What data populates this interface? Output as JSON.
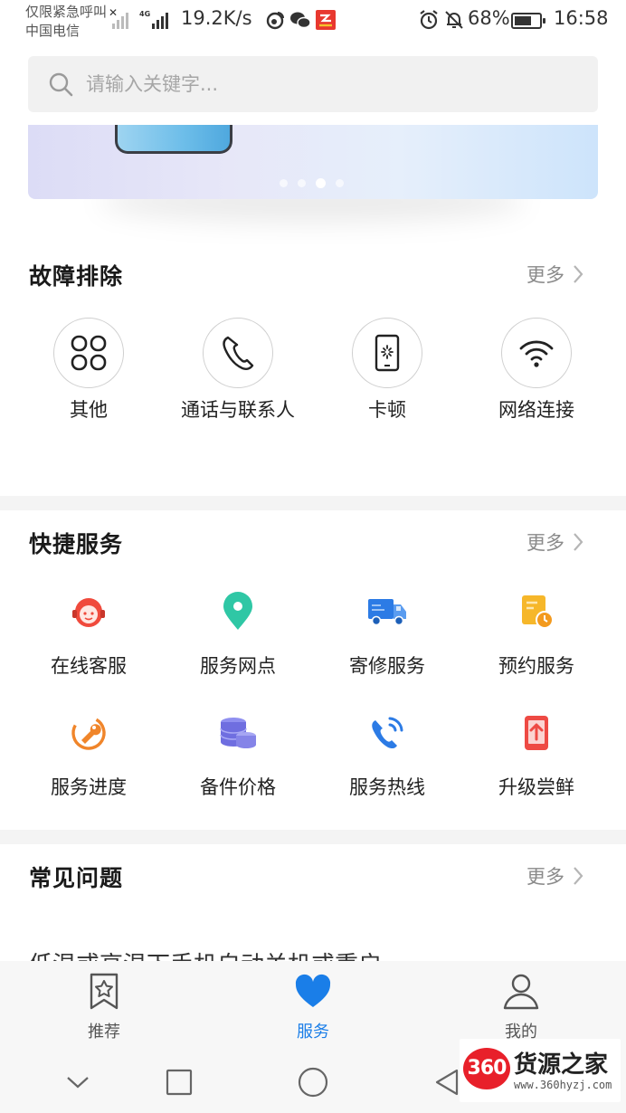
{
  "status_bar": {
    "carrier_line1": "仅限紧急呼叫",
    "carrier_line2": "中国电信",
    "net_speed": "19.2K/s",
    "network_type": "4G",
    "battery_percent": "68%",
    "battery_level": 0.68,
    "time": "16:58",
    "icons": [
      "close-icon",
      "signal-icon",
      "4g-signal-icon",
      "weibo-icon",
      "wechat-icon",
      "app-notification-icon",
      "alarm-icon",
      "mute-bell-icon",
      "battery-icon"
    ]
  },
  "search": {
    "placeholder": "请输入关键字..."
  },
  "banner": {
    "slide_count": 4,
    "active_slide": 3
  },
  "troubleshoot": {
    "title": "故障排除",
    "more": "更多",
    "items": [
      {
        "label": "其他",
        "icon": "four-petal-icon"
      },
      {
        "label": "通话与联系人",
        "icon": "phone-call-icon"
      },
      {
        "label": "卡顿",
        "icon": "phone-loading-icon"
      },
      {
        "label": "网络连接",
        "icon": "wifi-icon"
      }
    ]
  },
  "quick_services": {
    "title": "快捷服务",
    "more": "更多",
    "items": [
      {
        "label": "在线客服",
        "icon": "customer-service-icon",
        "color": "#f04a3c"
      },
      {
        "label": "服务网点",
        "icon": "location-pin-icon",
        "color": "#2fc7a5"
      },
      {
        "label": "寄修服务",
        "icon": "truck-icon",
        "color": "#2c7be5"
      },
      {
        "label": "预约服务",
        "icon": "appointment-icon",
        "color": "#f6b72a"
      },
      {
        "label": "服务进度",
        "icon": "wrench-progress-icon",
        "color": "#f0852a"
      },
      {
        "label": "备件价格",
        "icon": "coins-stack-icon",
        "color": "#6f6ee0"
      },
      {
        "label": "服务热线",
        "icon": "hotline-phone-icon",
        "color": "#2c7be5"
      },
      {
        "label": "升级尝鲜",
        "icon": "upgrade-phone-icon",
        "color": "#ee4a44"
      }
    ]
  },
  "faq": {
    "title": "常见问题",
    "more": "更多",
    "first_item_clipped": "低温或高温下手机自动关机或重启"
  },
  "tab_bar": {
    "tabs": [
      {
        "label": "推荐",
        "icon": "bookmark-star-icon",
        "active": false
      },
      {
        "label": "服务",
        "icon": "heart-icon",
        "active": true
      },
      {
        "label": "我的",
        "icon": "person-icon",
        "active": false
      }
    ]
  },
  "nav_bar": {
    "buttons": [
      "collapse-chevron-icon",
      "recents-square-icon",
      "home-circle-icon",
      "back-triangle-icon"
    ]
  },
  "watermark": {
    "logo_text": "360",
    "name": "货源之家",
    "url": "www.360hyzj.com"
  },
  "colors": {
    "accent_blue": "#1a7ee8",
    "section_gap": "#f4f4f4",
    "search_bg": "#f1f1f1"
  }
}
